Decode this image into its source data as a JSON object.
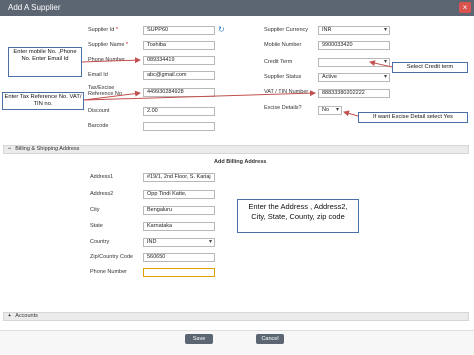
{
  "window": {
    "title": "Add A Supplier",
    "close": "×"
  },
  "supplier": {
    "id_label": "Supplier Id",
    "id_value": "SUPP60",
    "name_label": "Supplier Name",
    "name_value": "Toshiba",
    "phone_label": "Phone Number",
    "phone_value": "089334419",
    "email_label": "Email Id",
    "email_value": "abc@gmail.com",
    "tax_label_1": "Tax/Excise",
    "tax_label_2": "Reference No",
    "tax_value": "449930284928",
    "discount_label": "Discount",
    "discount_value": "2.00",
    "barcode_label": "Barcode",
    "barcode_value": "",
    "currency_label": "Supplier Currency",
    "currency_value": "INR",
    "mobile_label": "Mobile Number",
    "mobile_value": "9900033420",
    "credit_label": "Credit Term",
    "credit_value": "",
    "status_label": "Supplier Status",
    "status_value": "Active",
    "vat_label": "VAT / TIN Number",
    "vat_value": "88833380202222",
    "excise_label": "Excise Details?",
    "excise_value": "No"
  },
  "billing": {
    "section_label": "Billing & Shipping Address",
    "section_symbol": "−",
    "heading": "Add Billing Address",
    "address1_label": "Address1",
    "address1_value": "#19/1, 2nd Floor, S. Kariaj",
    "address2_label": "Address2",
    "address2_value": "Opp Tindi Katte,",
    "city_label": "City",
    "city_value": "Bengaluru",
    "state_label": "State",
    "state_value": "Karnataka",
    "country_label": "Country",
    "country_value": "IND",
    "zip_label": "Zip/Country Code",
    "zip_value": "560650",
    "phone_label": "Phone Number",
    "phone_value": ""
  },
  "accounts": {
    "section_label": "Accounts",
    "section_symbol": "+"
  },
  "buttons": {
    "save": "Save",
    "cancel": "Cancel"
  },
  "callouts": {
    "mobile": "Enter mobile No. ,Phone No. Enter Email Id",
    "tax": "Enter Tax Reference No. VAT/ TIN no.",
    "credit": "Select Credit term",
    "excise": "If want Excise Detail select Yes",
    "address": "Enter the Address , Address2, City, State, County, zip code"
  },
  "colors": {
    "titlebar": "#5b6672",
    "callout_border": "#4a6fa5",
    "arrow": "#c0504d"
  }
}
